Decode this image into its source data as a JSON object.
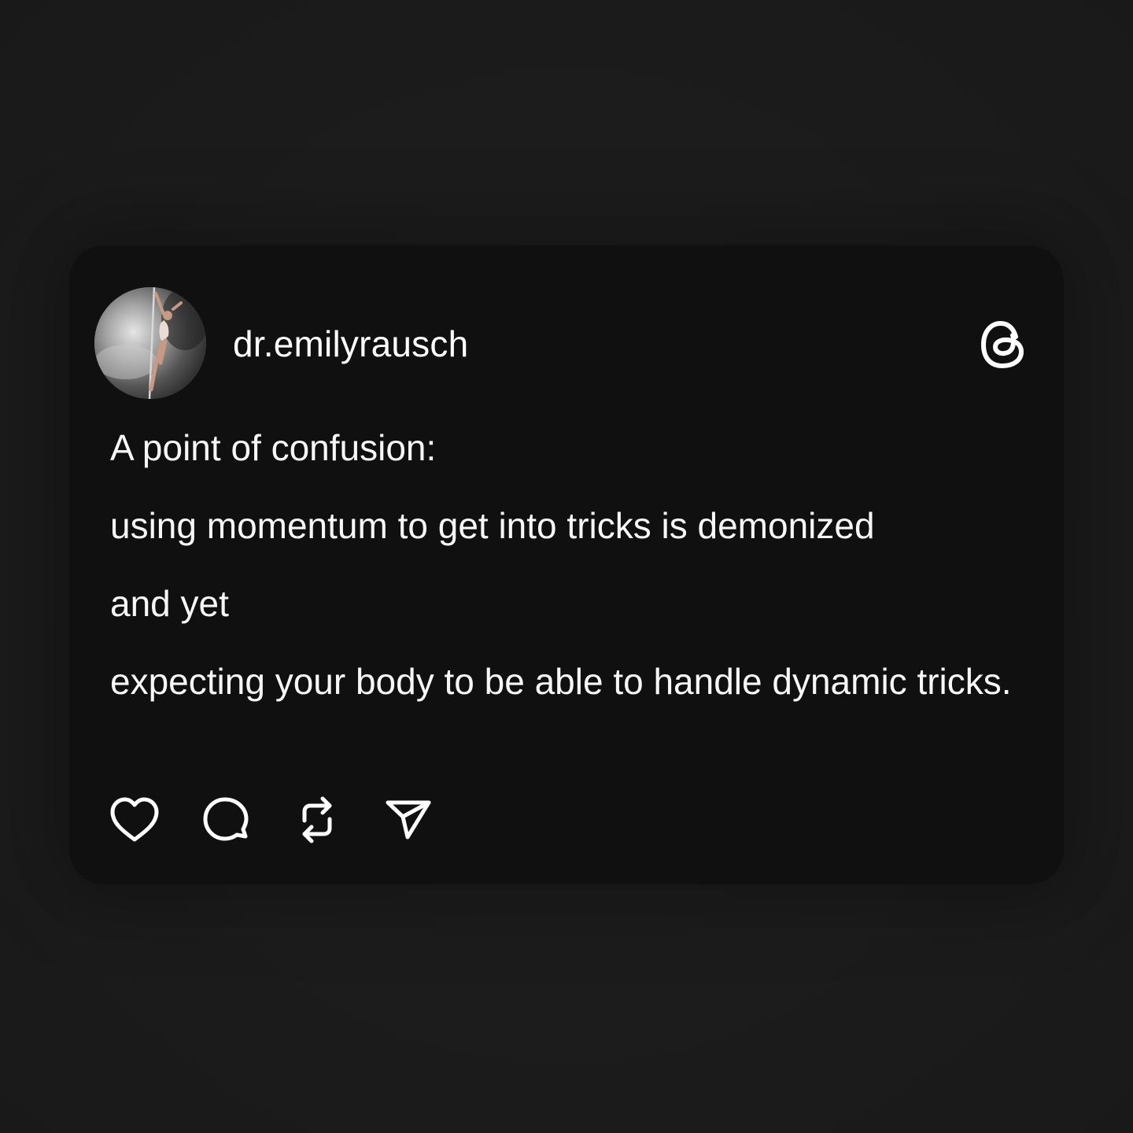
{
  "post": {
    "username": "dr.emilyrausch",
    "paragraphs": [
      "A point of confusion:",
      "using momentum to get into tricks is demonized",
      "and yet",
      "expecting your body to be able to handle dynamic tricks."
    ]
  },
  "icons": {
    "brand": "threads-logo-icon",
    "actions": [
      "heart-icon",
      "comment-icon",
      "repost-icon",
      "share-icon"
    ]
  },
  "colors": {
    "background": "#1c1c1c",
    "card": "#101010",
    "text": "#f5f5f5"
  }
}
